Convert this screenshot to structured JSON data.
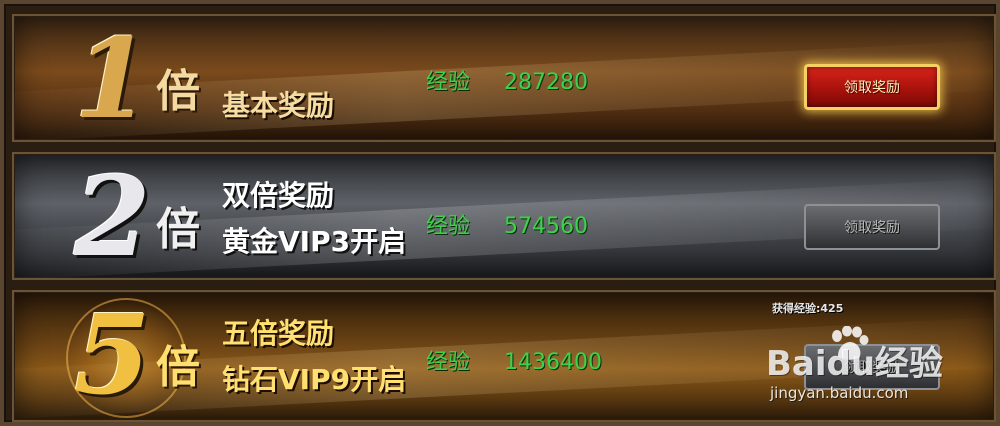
{
  "rows": [
    {
      "multiplier": "1",
      "bei": "倍",
      "title_lines": [
        "基本奖励"
      ],
      "exp_label": "经验",
      "exp_value": "287280",
      "button": {
        "label": "领取奖励",
        "state": "active"
      }
    },
    {
      "multiplier": "2",
      "bei": "倍",
      "title_lines": [
        "双倍奖励",
        "黄金VIP3开启"
      ],
      "exp_label": "经验",
      "exp_value": "574560",
      "button": {
        "label": "领取奖励",
        "state": "disabled"
      }
    },
    {
      "multiplier": "5",
      "bei": "倍",
      "title_lines": [
        "五倍奖励",
        "钻石VIP9开启"
      ],
      "exp_label": "经验",
      "exp_value": "1436400",
      "gained_exp": "获得经验:425",
      "button": {
        "label": "领取奖励",
        "state": "disabled"
      }
    }
  ],
  "watermark": {
    "brand": "Baidu经验",
    "url": "jingyan.baidu.com",
    "icon": "paw-icon"
  },
  "colors": {
    "exp_green": "#3ed24a",
    "active_button": "#c81a12",
    "gold": "#f2c040"
  }
}
